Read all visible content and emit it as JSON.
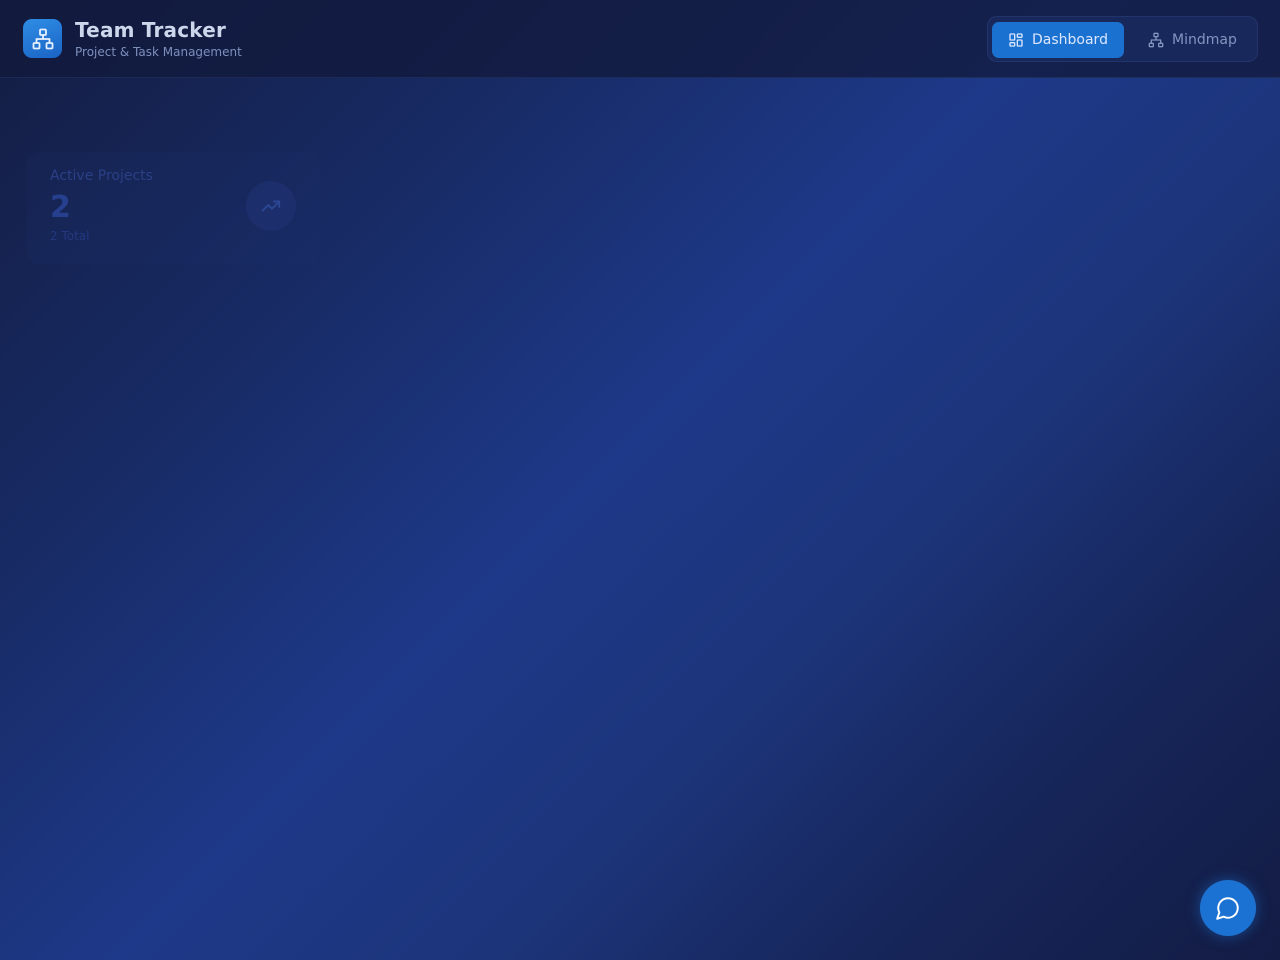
{
  "app": {
    "title": "Team Tracker",
    "subtitle": "Project & Task Management",
    "logo_icon": "sitemap-icon"
  },
  "nav": {
    "items": [
      {
        "label": "Dashboard",
        "icon": "dashboard-grid-icon",
        "active": true
      },
      {
        "label": "Mindmap",
        "icon": "hierarchy-icon",
        "active": false
      }
    ]
  },
  "stats": {
    "active_projects": {
      "label": "Active Projects",
      "value": "2",
      "sub": "2 Total",
      "icon": "trending-up-icon"
    }
  },
  "chat": {
    "icon": "chat-bubble-icon"
  },
  "colors": {
    "accent": "#1b71cf",
    "header_bg": "#121a3c",
    "background_dark": "#141d42",
    "background_light": "#1e3989"
  }
}
